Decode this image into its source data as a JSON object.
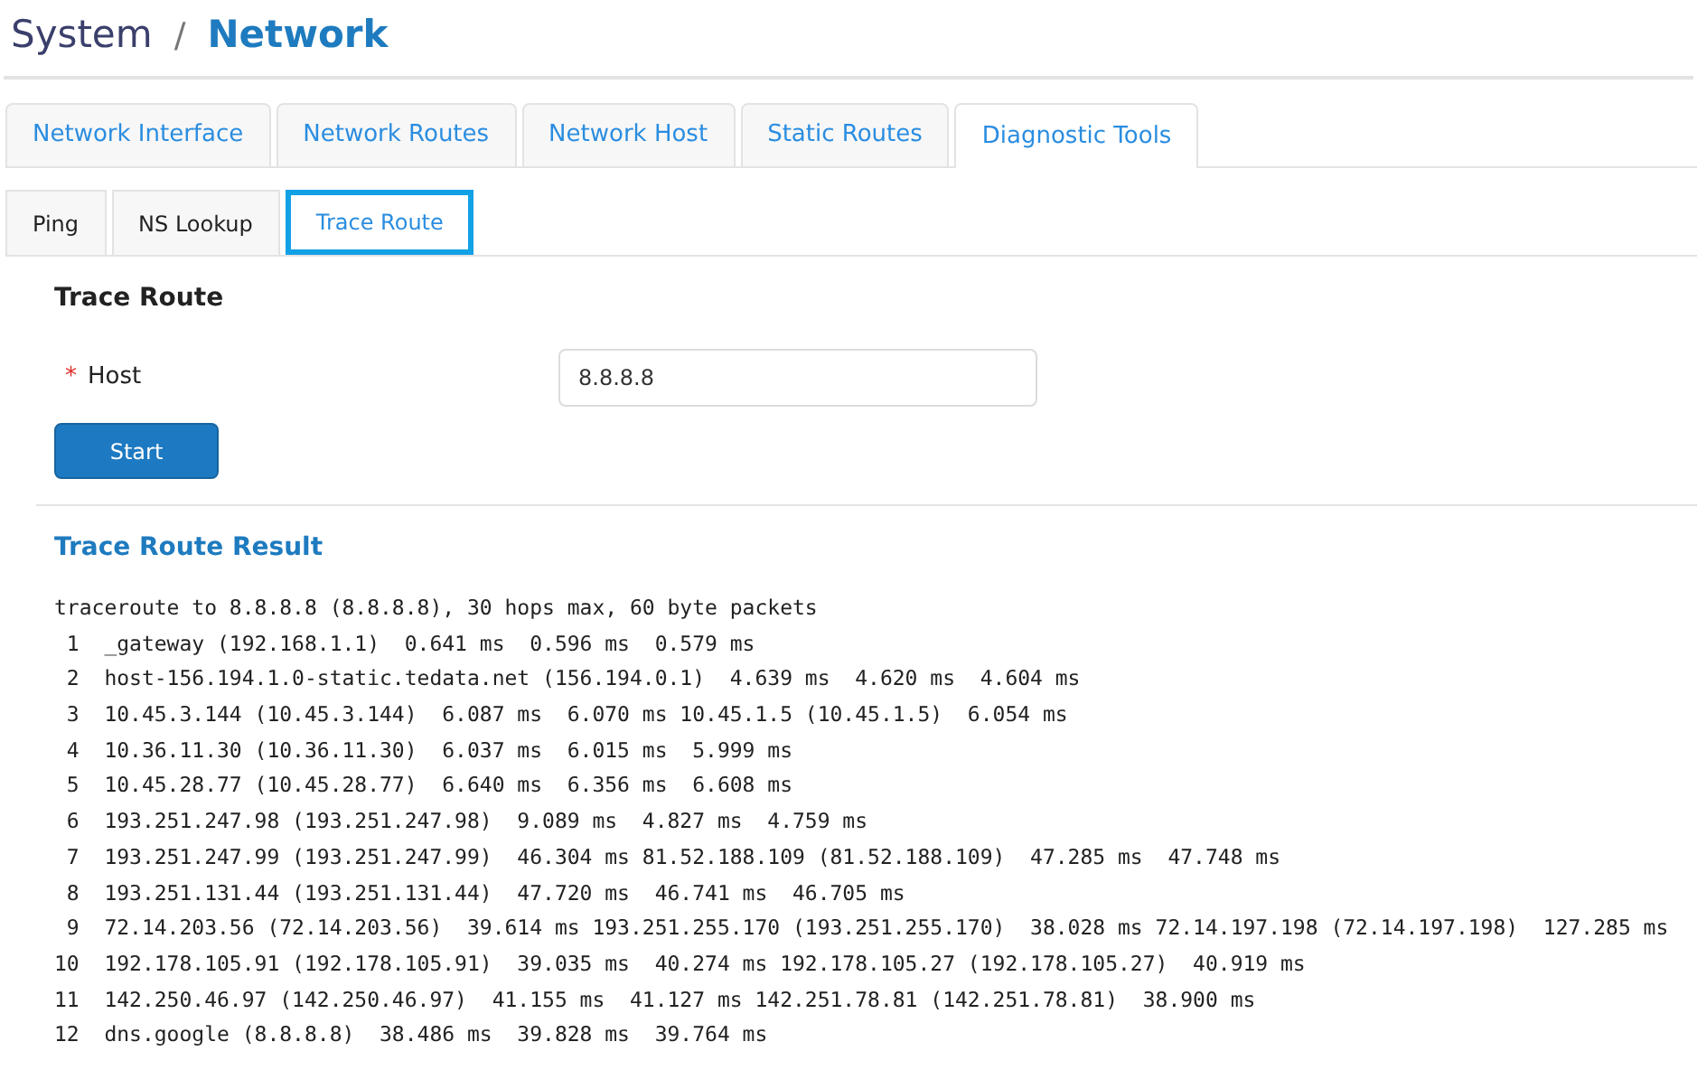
{
  "breadcrumb": {
    "parent": "System",
    "separator": "/",
    "current": "Network"
  },
  "tabs": [
    {
      "label": "Network Interface",
      "selected": false
    },
    {
      "label": "Network Routes",
      "selected": false
    },
    {
      "label": "Network Host",
      "selected": false
    },
    {
      "label": "Static Routes",
      "selected": false
    },
    {
      "label": "Diagnostic Tools",
      "selected": true
    }
  ],
  "subtabs": [
    {
      "label": "Ping",
      "selected": false
    },
    {
      "label": "NS Lookup",
      "selected": false
    },
    {
      "label": "Trace Route",
      "selected": true
    }
  ],
  "form": {
    "title": "Trace Route",
    "required_mark": "*",
    "host_label": "Host",
    "host_value": "8.8.8.8",
    "start_button": "Start"
  },
  "result": {
    "title": "Trace Route Result",
    "lines": [
      "traceroute to 8.8.8.8 (8.8.8.8), 30 hops max, 60 byte packets",
      " 1  _gateway (192.168.1.1)  0.641 ms  0.596 ms  0.579 ms",
      " 2  host-156.194.1.0-static.tedata.net (156.194.0.1)  4.639 ms  4.620 ms  4.604 ms",
      " 3  10.45.3.144 (10.45.3.144)  6.087 ms  6.070 ms 10.45.1.5 (10.45.1.5)  6.054 ms",
      " 4  10.36.11.30 (10.36.11.30)  6.037 ms  6.015 ms  5.999 ms",
      " 5  10.45.28.77 (10.45.28.77)  6.640 ms  6.356 ms  6.608 ms",
      " 6  193.251.247.98 (193.251.247.98)  9.089 ms  4.827 ms  4.759 ms",
      " 7  193.251.247.99 (193.251.247.99)  46.304 ms 81.52.188.109 (81.52.188.109)  47.285 ms  47.748 ms",
      " 8  193.251.131.44 (193.251.131.44)  47.720 ms  46.741 ms  46.705 ms",
      " 9  72.14.203.56 (72.14.203.56)  39.614 ms 193.251.255.170 (193.251.255.170)  38.028 ms 72.14.197.198 (72.14.197.198)  127.285 ms",
      "10  192.178.105.91 (192.178.105.91)  39.035 ms  40.274 ms 192.178.105.27 (192.178.105.27)  40.919 ms",
      "11  142.250.46.97 (142.250.46.97)  41.155 ms  41.127 ms 142.251.78.81 (142.251.78.81)  38.900 ms",
      "12  dns.google (8.8.8.8)  38.486 ms  39.828 ms  39.764 ms"
    ]
  }
}
